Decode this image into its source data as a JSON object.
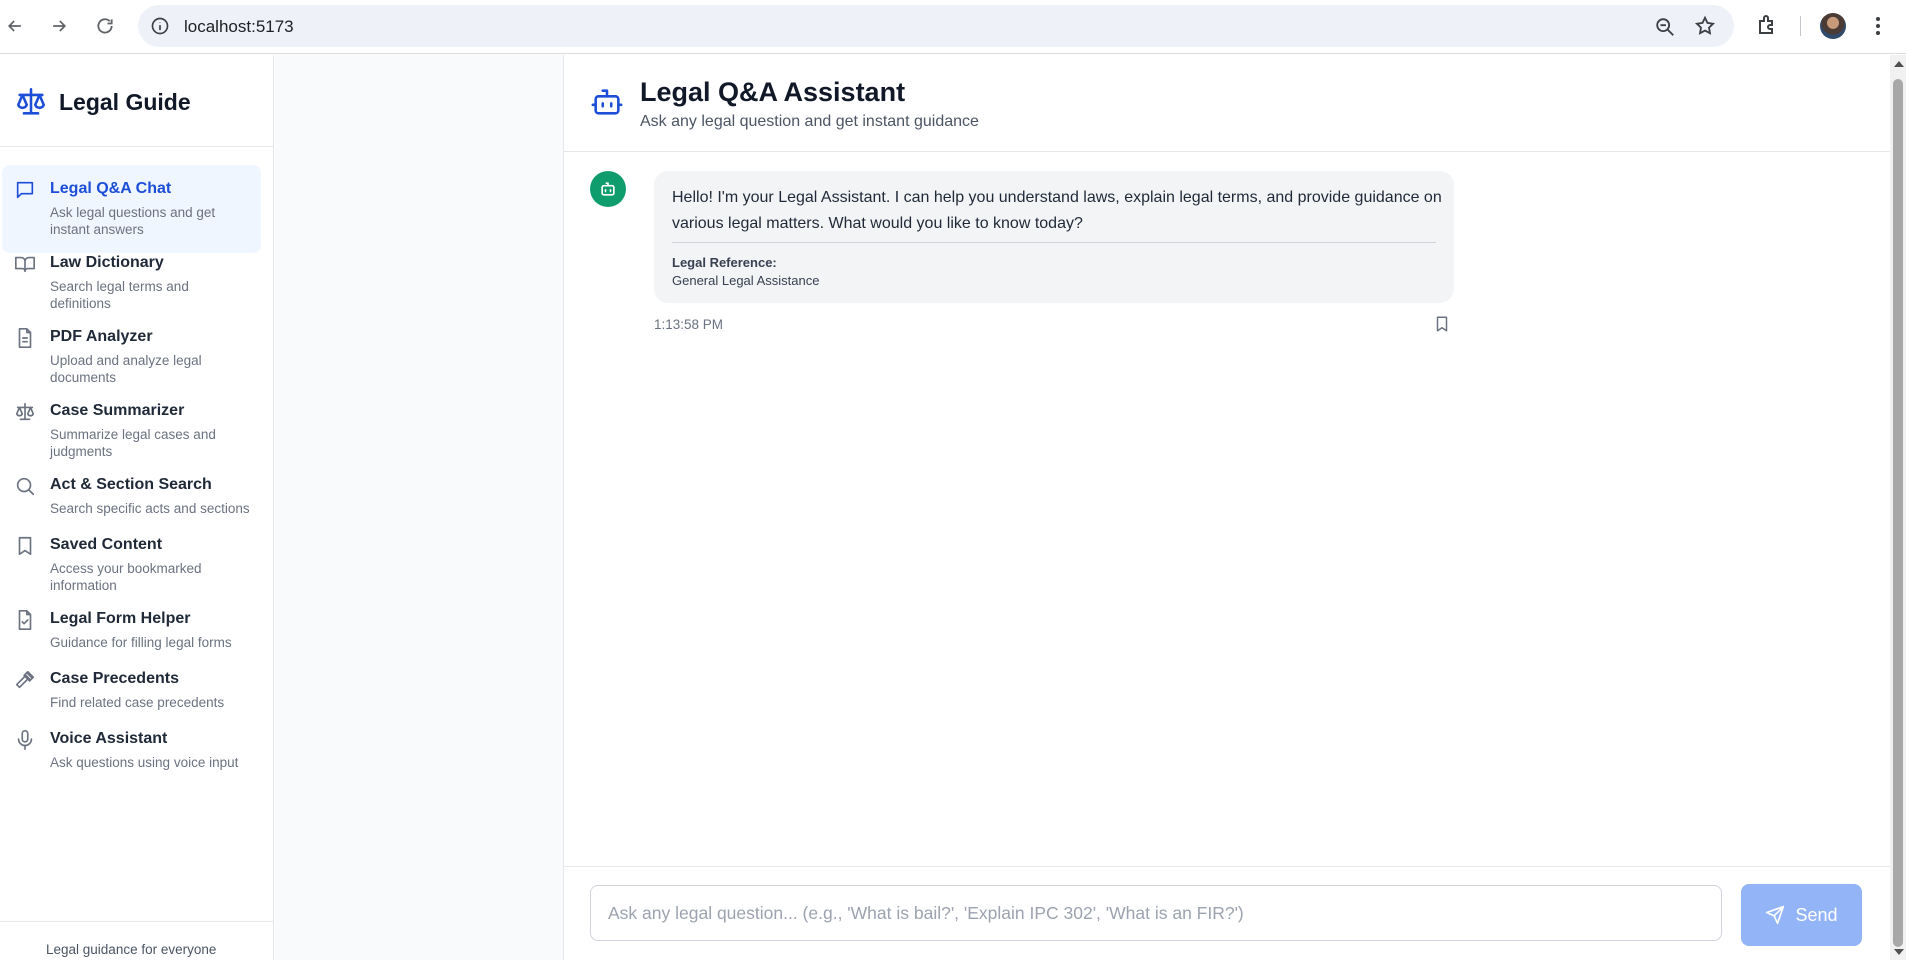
{
  "browser": {
    "url": "localhost:5173",
    "icons": [
      "back-arrow-icon",
      "forward-arrow-icon",
      "reload-icon",
      "site-info-icon",
      "zoom-icon",
      "bookmark-star-icon",
      "extensions-icon",
      "profile-avatar",
      "more-menu-icon"
    ]
  },
  "sidebar": {
    "brand": "Legal Guide",
    "brand_icon": "scale-icon",
    "items": [
      {
        "label": "Legal Q&A Chat",
        "description": "Ask legal questions and get instant answers",
        "icon": "message-icon",
        "active": true
      },
      {
        "label": "Law Dictionary",
        "description": "Search legal terms and definitions",
        "icon": "book-icon",
        "active": false
      },
      {
        "label": "PDF Analyzer",
        "description": "Upload and analyze legal documents",
        "icon": "document-icon",
        "active": false
      },
      {
        "label": "Case Summarizer",
        "description": "Summarize legal cases and judgments",
        "icon": "scale-icon",
        "active": false
      },
      {
        "label": "Act & Section Search",
        "description": "Search specific acts and sections",
        "icon": "search-icon",
        "active": false
      },
      {
        "label": "Saved Content",
        "description": "Access your bookmarked information",
        "icon": "bookmark-icon",
        "active": false
      },
      {
        "label": "Legal Form Helper",
        "description": "Guidance for filling legal forms",
        "icon": "file-check-icon",
        "active": false
      },
      {
        "label": "Case Precedents",
        "description": "Find related case precedents",
        "icon": "gavel-icon",
        "active": false
      },
      {
        "label": "Voice Assistant",
        "description": "Ask questions using voice input",
        "icon": "microphone-icon",
        "active": false
      }
    ],
    "footer": "Legal guidance for everyone"
  },
  "chat": {
    "title": "Legal Q&A Assistant",
    "subtitle": "Ask any legal question and get instant guidance",
    "messages": [
      {
        "sender": "assistant",
        "text": "Hello! I'm your Legal Assistant. I can help you understand laws, explain legal terms, and provide guidance on various legal matters. What would you like to know today?",
        "reference_label": "Legal Reference:",
        "reference_value": "General Legal Assistance",
        "timestamp": "1:13:58 PM"
      }
    ],
    "input": {
      "value": "",
      "placeholder": "Ask any legal question... (e.g., 'What is bail?', 'Explain IPC 302', 'What is an FIR?')"
    },
    "send_label": "Send"
  },
  "colors": {
    "accent": "#1d4ed8",
    "active_bg": "#eff6ff",
    "bot_avatar": "#0f9d6e",
    "send_button": "#93b4f6",
    "bubble_bg": "#f3f4f6"
  }
}
